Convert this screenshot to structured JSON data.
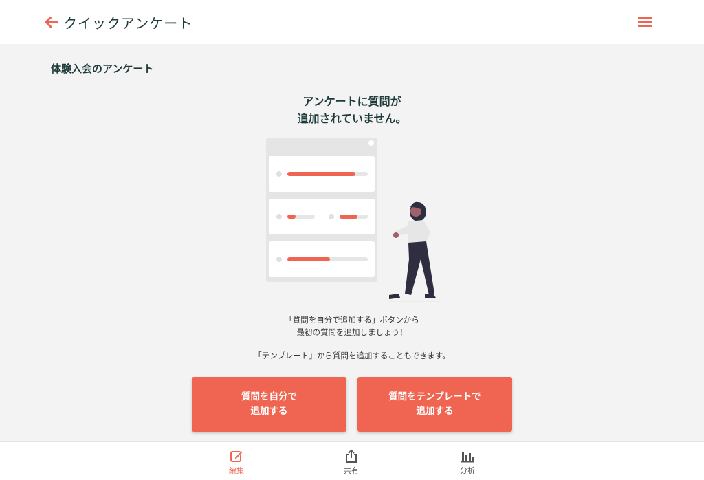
{
  "header": {
    "title": "クイックアンケート",
    "back_icon": "arrow-left-icon",
    "menu_icon": "hamburger-menu-icon"
  },
  "survey": {
    "title": "体験入会のアンケート"
  },
  "empty_state": {
    "heading_line1": "アンケートに質問が",
    "heading_line2": "追加されていません。",
    "hint_line1": "「質問を自分で追加する」ボタンから",
    "hint_line2": "最初の質問を追加しましょう！",
    "hint_line3": "「テンプレート」から質問を追加することもできます。"
  },
  "actions": {
    "add_self_line1": "質問を自分で",
    "add_self_line2": "追加する",
    "add_template_line1": "質問をテンプレートで",
    "add_template_line2": "追加する"
  },
  "bottom_nav": {
    "items": [
      {
        "label": "編集",
        "icon": "edit-icon",
        "active": true
      },
      {
        "label": "共有",
        "icon": "share-icon",
        "active": false
      },
      {
        "label": "分析",
        "icon": "bar-chart-icon",
        "active": false
      }
    ]
  },
  "colors": {
    "accent": "#ef6552",
    "text_dark": "#1e3a3a",
    "background": "#f3f3f3"
  }
}
